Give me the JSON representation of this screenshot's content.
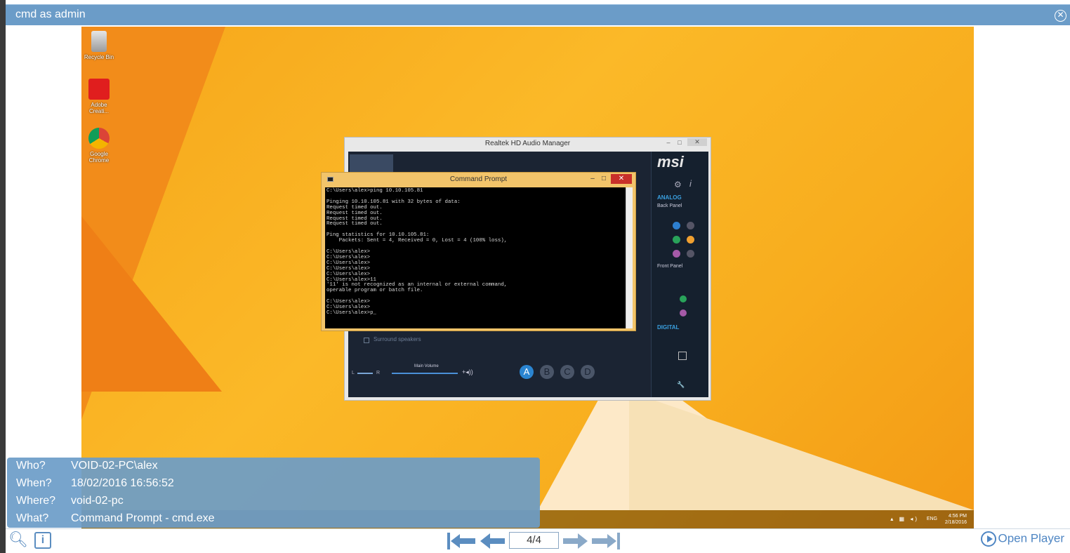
{
  "window": {
    "title": "cmd as admin"
  },
  "desktop": {
    "icons": [
      {
        "label": "Recycle Bin",
        "icon": "recycle-bin-icon"
      },
      {
        "label": "Adobe Creati...",
        "icon": "adobe-creative-cloud-icon"
      },
      {
        "label": "Google Chrome",
        "icon": "chrome-icon"
      }
    ],
    "taskbar": {
      "lang": "ENG",
      "time": "4:56 PM",
      "date": "2/18/2016"
    }
  },
  "realtek": {
    "title": "Realtek HD Audio Manager",
    "brand": "msi",
    "analog": "ANALOG",
    "back_panel": "Back Panel",
    "front_panel": "Front Panel",
    "digital": "DIGITAL",
    "surround": "Surround speakers",
    "main_volume": "Main Volume",
    "vol_l": "L",
    "vol_r": "R",
    "presets": [
      "A",
      "B",
      "C",
      "D"
    ]
  },
  "cmd": {
    "title": "Command Prompt",
    "console": "C:\\Users\\alex>ping 10.10.105.81\n\nPinging 10.10.105.81 with 32 bytes of data:\nRequest timed out.\nRequest timed out.\nRequest timed out.\nRequest timed out.\n\nPing statistics for 10.10.105.81:\n    Packets: Sent = 4, Received = 0, Lost = 4 (100% loss),\n\nC:\\Users\\alex>\nC:\\Users\\alex>\nC:\\Users\\alex>\nC:\\Users\\alex>\nC:\\Users\\alex>\nC:\\Users\\alex>11\n'11' is not recognized as an internal or external command,\noperable program or batch file.\n\nC:\\Users\\alex>\nC:\\Users\\alex>\nC:\\Users\\alex>p_"
  },
  "info": {
    "who_label": "Who?",
    "who": "VOID-02-PC\\alex",
    "when_label": "When?",
    "when": "18/02/2016 16:56:52",
    "where_label": "Where?",
    "where": "void-02-pc",
    "what_label": "What?",
    "what": "Command Prompt - cmd.exe"
  },
  "nav": {
    "page": "4/4",
    "open_player": "Open Player"
  },
  "colors": {
    "accent": "#6b9cc8",
    "link": "#4f86c3"
  }
}
